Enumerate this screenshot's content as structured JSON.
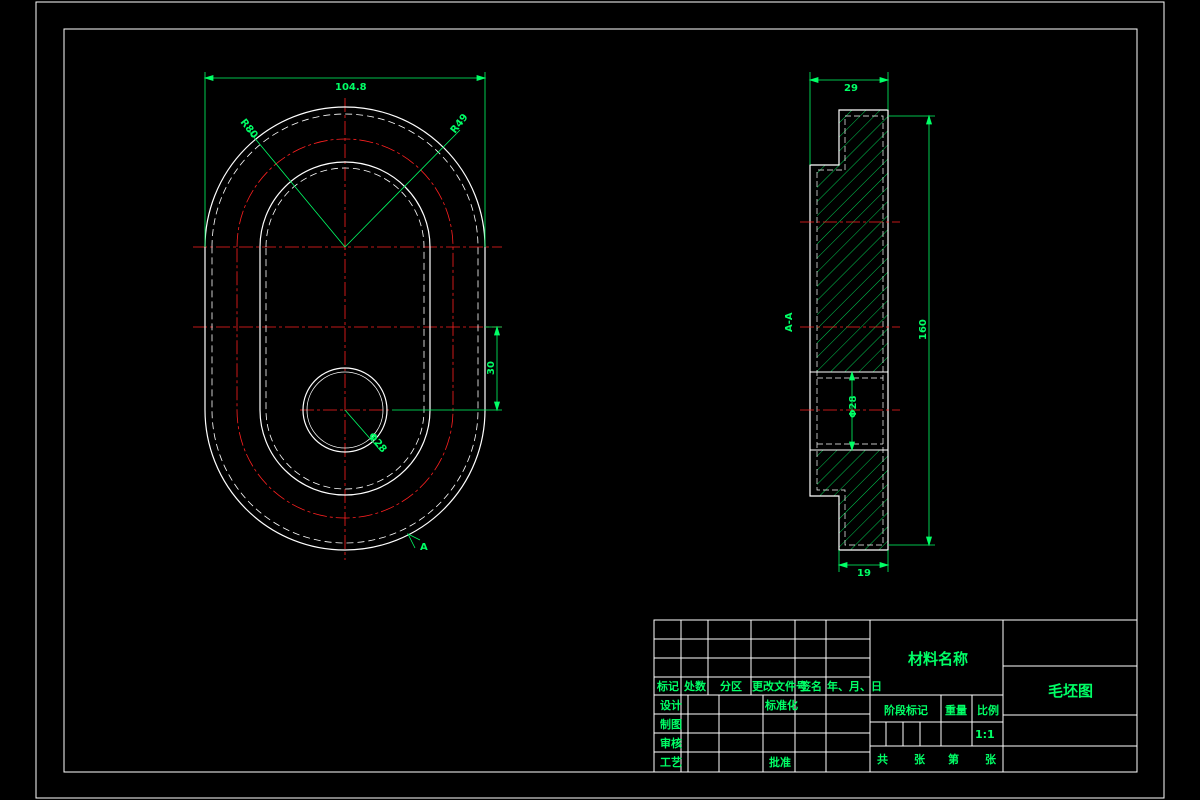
{
  "drawing": {
    "colors": {
      "background": "#000000",
      "outline": "#ffffff",
      "centerline": "#ff2020",
      "dimension": "#00ff66",
      "hatch": "#00ff66"
    },
    "front_view": {
      "width_label": "104.8",
      "r_outer_label": "R80",
      "r_inner_label": "R49",
      "offset_label": "30",
      "hole_label": "Φ28",
      "section_marker": "A"
    },
    "section_view": {
      "top_width_label": "29",
      "height_label": "160",
      "bore_label": "Φ28",
      "bottom_width_label": "19",
      "section_name": "A-A"
    }
  },
  "title_block": {
    "material_name": "材料名称",
    "drawing_title": "毛坯图",
    "revision_headers": [
      "标记",
      "处数",
      "分区",
      "更改文件号",
      "签名",
      "年、月、日"
    ],
    "row_labels": [
      "设计",
      "制图",
      "审核",
      "工艺"
    ],
    "standardize_label": "标准化",
    "approve_label": "批准",
    "stage_mark_label": "阶段标记",
    "weight_label": "重量",
    "scale_label": "比例",
    "scale_value": "1:1",
    "sheet_total_label": "共",
    "sheet_unit_label": "张",
    "sheet_no_label": "第",
    "sheet_unit2_label": "张"
  }
}
